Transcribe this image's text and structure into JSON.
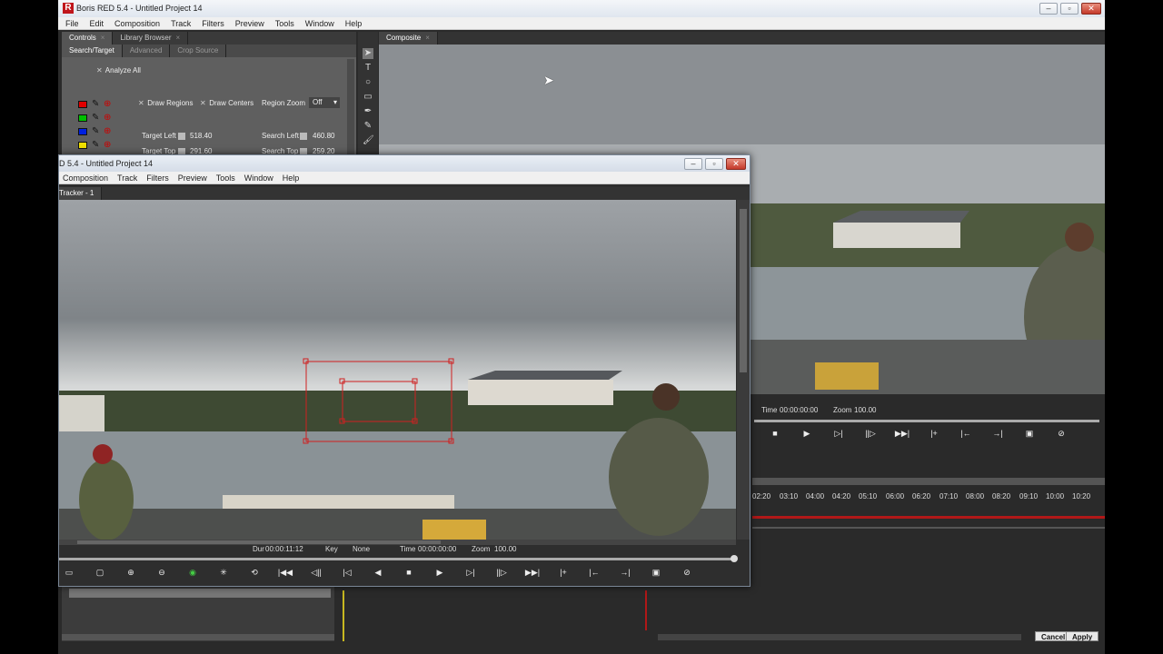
{
  "app": {
    "title": "Boris RED 5.4 - Untitled Project 14",
    "logo_letter": "R",
    "menu": [
      "File",
      "Edit",
      "Composition",
      "Track",
      "Filters",
      "Preview",
      "Tools",
      "Window",
      "Help"
    ]
  },
  "controls_panel": {
    "tabs": [
      "Controls",
      "Library Browser"
    ],
    "subtabs": [
      "Search/Target",
      "Advanced",
      "Crop Source"
    ],
    "analyze_all": "Analyze All",
    "draw_regions": "Draw Regions",
    "draw_centers": "Draw Centers",
    "region_zoom_label": "Region Zoom",
    "region_zoom_value": "Off",
    "swatch_colors": [
      "#e00000",
      "#00c000",
      "#0020e0",
      "#f0e000"
    ],
    "target_left_label": "Target Left",
    "target_left_value": "518.40",
    "target_top_label": "Target Top",
    "target_top_value": "291.60",
    "search_left_label": "Search Left",
    "search_left_value": "460.80",
    "search_top_label": "Search Top",
    "search_top_value": "259.20"
  },
  "composite": {
    "tab": "Composite",
    "time_label": "Time",
    "time_value": "00:00:00:00",
    "zoom_label": "Zoom",
    "zoom_value": "100.00",
    "ruler": [
      "02:20",
      "03:10",
      "04:00",
      "04:20",
      "05:10",
      "06:00",
      "06:20",
      "07:10",
      "08:00",
      "08:20",
      "09:10",
      "10:00",
      "10:20"
    ]
  },
  "tracker_window": {
    "title": "D 5.4 - Untitled Project 14",
    "menu": [
      "Composition",
      "Track",
      "Filters",
      "Preview",
      "Tools",
      "Window",
      "Help"
    ],
    "tab": "Tracker - 1",
    "dur_label": "Dur",
    "dur_value": "00:00:11:12",
    "key_label": "Key",
    "key_value": "None",
    "time_label": "Time",
    "time_value": "00:00:00:00",
    "zoom_label": "Zoom",
    "zoom_value": "100.00"
  },
  "bottom": {
    "cancel": "Cancel",
    "apply": "Apply"
  }
}
